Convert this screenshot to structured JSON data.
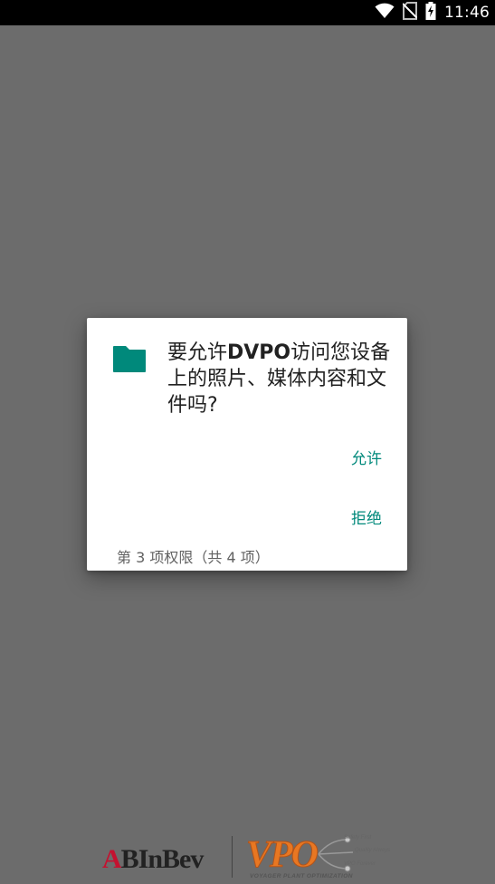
{
  "status_bar": {
    "time": "11:46",
    "icons": [
      "wifi-icon",
      "no-sim-icon",
      "battery-charging-icon"
    ]
  },
  "dialog": {
    "icon": "folder-icon",
    "accent_color": "#00897b",
    "message_prefix": "要允许",
    "app_name": "DVPO",
    "message_suffix": "访问您设备上的照片、媒体内容和文件吗?",
    "allow_label": "允许",
    "deny_label": "拒绝",
    "counter": "第 3 项权限（共 4 项）"
  },
  "footer": {
    "brand_ab_a": "A",
    "brand_ab_b": "B",
    "brand_ab_rest": "InBev",
    "brand_vpo": "VPO",
    "brand_vpo_subtitle": "VOYAGER PLANT OPTIMIZATION",
    "taglines": [
      "Safety First",
      "Quality Always",
      "VPO Forever"
    ]
  }
}
